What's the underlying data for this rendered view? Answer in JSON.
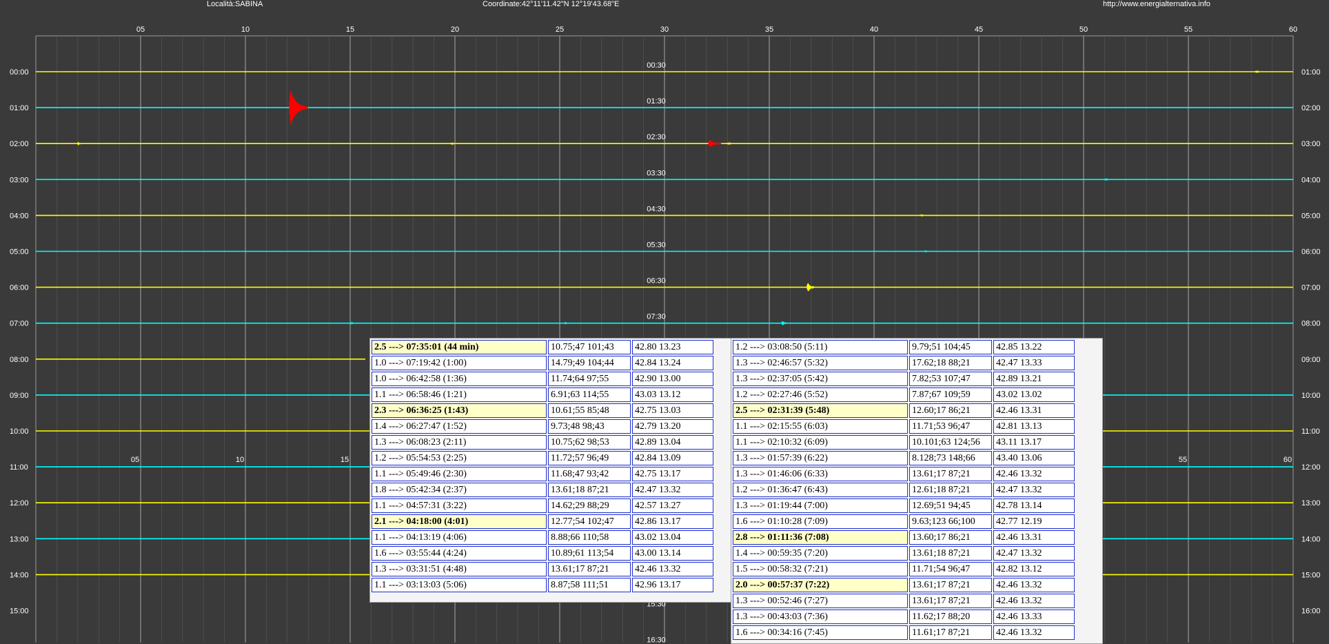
{
  "header": {
    "locality": "Località:SABINA",
    "coordinates": "Coordinate:42°11'11.42\"N  12°19'43.68\"E",
    "url": "http://www.energialternativa.info"
  },
  "plot": {
    "minute_ticks": [
      "05",
      "10",
      "15",
      "20",
      "25",
      "30",
      "35",
      "40",
      "45",
      "50",
      "55",
      "60"
    ],
    "left_hours": [
      "00:00",
      "01:00",
      "02:00",
      "03:00",
      "04:00",
      "05:00",
      "06:00",
      "07:00",
      "08:00",
      "09:00",
      "10:00",
      "11:00",
      "12:00",
      "13:00",
      "14:00",
      "15:00"
    ],
    "right_hours": [
      "01:00",
      "02:00",
      "03:00",
      "04:00",
      "05:00",
      "06:00",
      "07:00",
      "08:00",
      "09:00",
      "10:00",
      "11:00",
      "12:00",
      "13:00",
      "14:00",
      "15:00",
      "16:00"
    ],
    "mid_labels": [
      "00:30",
      "01:30",
      "02:30",
      "03:30",
      "04:30",
      "05:30",
      "06:30",
      "07:30",
      "15:30",
      "16:30"
    ],
    "lower_minute_ticks": [
      "05",
      "10",
      "15",
      "55",
      "60"
    ],
    "colors": {
      "background": "#3a3a3a",
      "grid": "#9a9a9a",
      "trace_yellow": "#ffff00",
      "trace_cyan": "#00ffff",
      "event_red": "#ff0000"
    }
  },
  "events_left": [
    {
      "time": "2.5 ---> 07:35:01 (44 min)",
      "dist": "10.75;47 101;43",
      "coords": "42.80 13.23",
      "highlight": true
    },
    {
      "time": "1.0 ---> 07:19:42 (1:00)",
      "dist": "14.79;49 104;44",
      "coords": "42.84 13.24",
      "highlight": false
    },
    {
      "time": "1.0 ---> 06:42:58 (1:36)",
      "dist": "11.74;64 97;55",
      "coords": "42.90 13.00",
      "highlight": false
    },
    {
      "time": "1.1 ---> 06:58:46 (1:21)",
      "dist": "6.91;63 114;55",
      "coords": "43.03 13.12",
      "highlight": false
    },
    {
      "time": "2.3 ---> 06:36:25 (1:43)",
      "dist": "10.61;55 85;48",
      "coords": "42.75 13.03",
      "highlight": true
    },
    {
      "time": "1.4 ---> 06:27:47 (1:52)",
      "dist": "9.73;48 98;43",
      "coords": "42.79 13.20",
      "highlight": false
    },
    {
      "time": "1.3 ---> 06:08:23 (2:11)",
      "dist": "10.75;62 98;53",
      "coords": "42.89 13.04",
      "highlight": false
    },
    {
      "time": "1.2 ---> 05:54:53 (2:25)",
      "dist": "11.72;57 96;49",
      "coords": "42.84 13.09",
      "highlight": false
    },
    {
      "time": "1.1 ---> 05:49:46 (2:30)",
      "dist": "11.68;47 93;42",
      "coords": "42.75 13.17",
      "highlight": false
    },
    {
      "time": "1.8 ---> 05:42:34 (2:37)",
      "dist": "13.61;18 87;21",
      "coords": "42.47 13.32",
      "highlight": false
    },
    {
      "time": "1.1 ---> 04:57:31 (3:22)",
      "dist": "14.62;29 88;29",
      "coords": "42.57 13.27",
      "highlight": false
    },
    {
      "time": "2.1 ---> 04:18:00 (4:01)",
      "dist": "12.77;54 102;47",
      "coords": "42.86 13.17",
      "highlight": true
    },
    {
      "time": "1.1 ---> 04:13:19 (4:06)",
      "dist": "8.88;66 110;58",
      "coords": "43.02 13.04",
      "highlight": false
    },
    {
      "time": "1.6 ---> 03:55:44 (4:24)",
      "dist": "10.89;61 113;54",
      "coords": "43.00 13.14",
      "highlight": false
    },
    {
      "time": "1.3 ---> 03:31:51 (4:48)",
      "dist": "13.61;17 87;21",
      "coords": "42.46 13.32",
      "highlight": false
    },
    {
      "time": "1.1 ---> 03:13:03 (5:06)",
      "dist": "8.87;58 111;51",
      "coords": "42.96 13.17",
      "highlight": false
    }
  ],
  "events_right": [
    {
      "time": "1.2 ---> 03:08:50 (5:11)",
      "dist": "9.79;51 104;45",
      "coords": "42.85 13.22",
      "highlight": false
    },
    {
      "time": "1.3 ---> 02:46:57 (5:32)",
      "dist": "17.62;18 88;21",
      "coords": "42.47 13.33",
      "highlight": false
    },
    {
      "time": "1.3 ---> 02:37:05 (5:42)",
      "dist": "7.82;53 107;47",
      "coords": "42.89 13.21",
      "highlight": false
    },
    {
      "time": "1.2 ---> 02:27:46 (5:52)",
      "dist": "7.87;67 109;59",
      "coords": "43.02 13.02",
      "highlight": false
    },
    {
      "time": "2.5 ---> 02:31:39 (5:48)",
      "dist": "12.60;17 86;21",
      "coords": "42.46 13.31",
      "highlight": true
    },
    {
      "time": "1.1 ---> 02:15:55 (6:03)",
      "dist": "11.71;53 96;47",
      "coords": "42.81 13.13",
      "highlight": false
    },
    {
      "time": "1.1 ---> 02:10:32 (6:09)",
      "dist": "10.101;63 124;56",
      "coords": "43.11 13.17",
      "highlight": false
    },
    {
      "time": "1.3 ---> 01:57:39 (6:22)",
      "dist": "8.128;73 148;66",
      "coords": "43.40 13.06",
      "highlight": false
    },
    {
      "time": "1.3 ---> 01:46:06 (6:33)",
      "dist": "13.61;17 87;21",
      "coords": "42.46 13.32",
      "highlight": false
    },
    {
      "time": "1.2 ---> 01:36:47 (6:43)",
      "dist": "12.61;18 87;21",
      "coords": "42.47 13.32",
      "highlight": false
    },
    {
      "time": "1.3 ---> 01:19:44 (7:00)",
      "dist": "12.69;51 94;45",
      "coords": "42.78 13.14",
      "highlight": false
    },
    {
      "time": "1.6 ---> 01:10:28 (7:09)",
      "dist": "9.63;123 66;100",
      "coords": "42.77 12.19",
      "highlight": false
    },
    {
      "time": "2.8 ---> 01:11:36 (7:08)",
      "dist": "13.60;17 86;21",
      "coords": "42.46 13.31",
      "highlight": true
    },
    {
      "time": "1.4 ---> 00:59:35 (7:20)",
      "dist": "13.61;18 87;21",
      "coords": "42.47 13.32",
      "highlight": false
    },
    {
      "time": "1.5 ---> 00:58:32 (7:21)",
      "dist": "11.71;54 96;47",
      "coords": "42.82 13.12",
      "highlight": false
    },
    {
      "time": "2.0 ---> 00:57:37 (7:22)",
      "dist": "13.61;17 87;21",
      "coords": "42.46 13.32",
      "highlight": true
    },
    {
      "time": "1.3 ---> 00:52:46 (7:27)",
      "dist": "13.61;17 87;21",
      "coords": "42.46 13.32",
      "highlight": false
    },
    {
      "time": "1.3 ---> 00:43:03 (7:36)",
      "dist": "11.62;17 88;20",
      "coords": "42.46 13.33",
      "highlight": false
    },
    {
      "time": "1.6 ---> 00:34:16 (7:45)",
      "dist": "11.61;17 87;21",
      "coords": "42.46 13.32",
      "highlight": false
    }
  ]
}
